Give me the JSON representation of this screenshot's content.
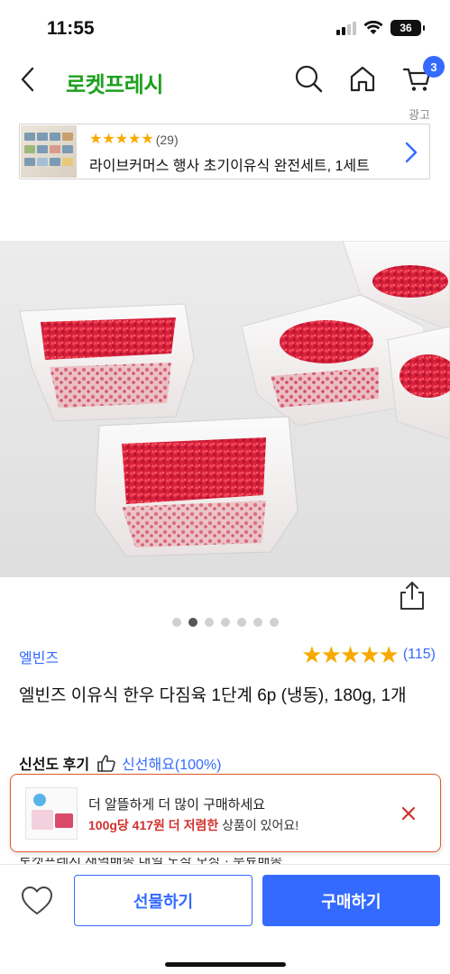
{
  "status_bar": {
    "time": "11:55",
    "battery": "36"
  },
  "header": {
    "title": "로켓프레시",
    "cart_count": "3"
  },
  "ad": {
    "label": "광고",
    "rating_count": "(29)",
    "title": "라이브커머스 행사 초기이유식 완전세트, 1세트"
  },
  "gallery": {
    "image_count": 7,
    "active_index": 1
  },
  "product": {
    "brand": "엘빈즈",
    "rating": 5,
    "review_count": "(115)",
    "title": "엘빈즈 이유식 한우 다짐육 1단계 6p (냉동), 180g, 1개",
    "freshness_label": "신선도 후기",
    "freshness_value": "신선해요(100%)"
  },
  "popup": {
    "line1": "더 알뜰하게 더 많이 구매하세요",
    "line2_highlight": "100g당 417원 더 저렴한",
    "line2_rest": " 상품이 있어요!"
  },
  "peek_text": "로켓프레시 새벽배송 내일 도착 보장 · 무료배송",
  "actions": {
    "gift": "선물하기",
    "buy": "구매하기"
  },
  "colors": {
    "accent": "#346aff",
    "brand_green": "#1ea01e",
    "star": "#f8a900",
    "highlight_red": "#d1322e",
    "popup_border": "#e05a2b"
  }
}
